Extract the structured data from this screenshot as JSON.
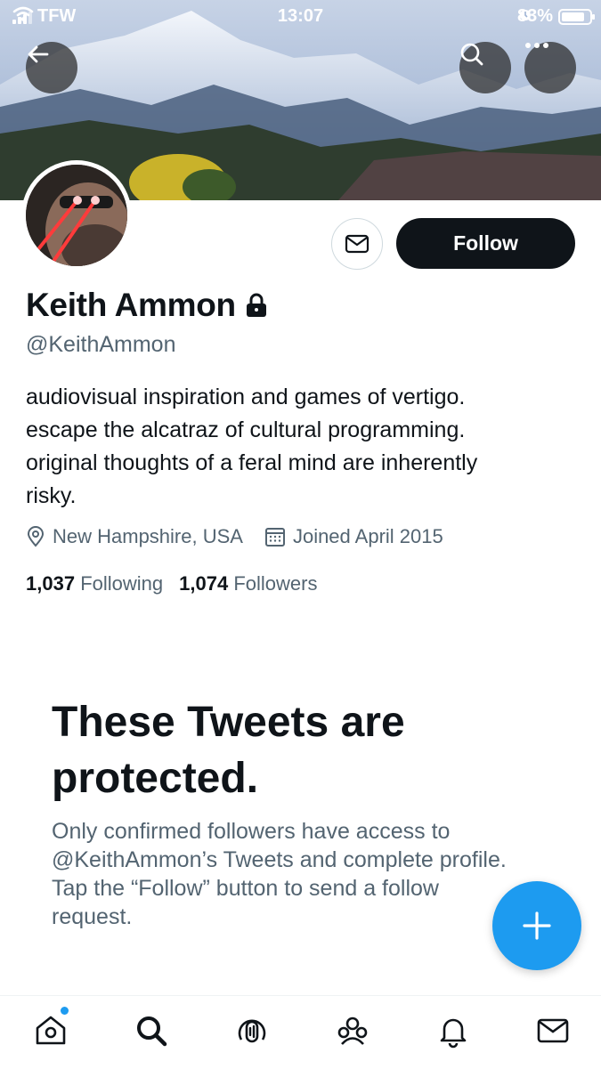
{
  "status_bar": {
    "carrier": "TFW",
    "time": "13:07",
    "battery": "83%",
    "battery_level": 0.83
  },
  "header": {
    "back_icon": "arrow-left-icon",
    "search_icon": "search-icon",
    "more_icon": "more-horizontal-icon"
  },
  "profile": {
    "name": "Keith Ammon",
    "protected_icon": "lock-icon",
    "handle": "@KeithAmmon",
    "bio_lines": [
      "audiovisual inspiration and games of vertigo.",
      "escape the alcatraz of cultural programming.",
      "original thoughts of a feral mind are inherently",
      "risky."
    ],
    "location": "New Hampshire, USA",
    "joined": "Joined April 2015",
    "following_count": "1,037",
    "following_label": "Following",
    "followers_count": "1,074",
    "followers_label": "Followers"
  },
  "actions": {
    "follow_label": "Follow",
    "message_icon": "envelope-icon"
  },
  "protected_notice": {
    "title": "These Tweets are protected.",
    "body": "Only confirmed followers have access to @KeithAmmon’s Tweets and complete profile. Tap the “Follow” button to send a follow request."
  },
  "fab": {
    "icon": "plus-icon"
  },
  "tabbar": {
    "items": [
      "home-icon",
      "search-icon",
      "spaces-icon",
      "communities-icon",
      "notifications-icon",
      "messages-icon"
    ]
  },
  "colors": {
    "accent": "#1d9bf0",
    "text_primary": "#0f1419",
    "text_secondary": "#536471",
    "follow_button": "#0f1419"
  }
}
